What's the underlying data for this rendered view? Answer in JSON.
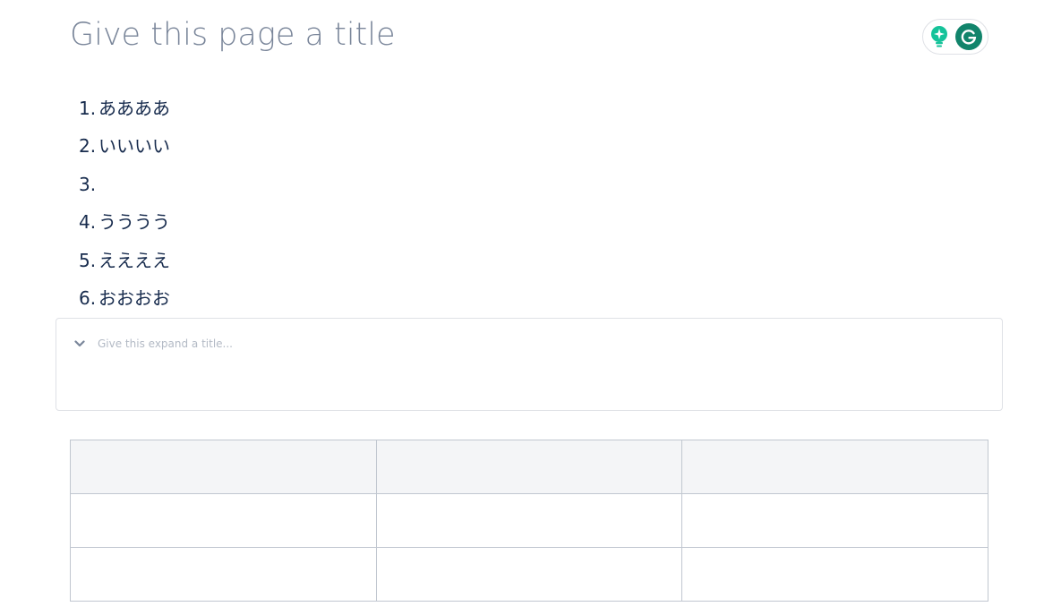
{
  "page": {
    "title_placeholder": "Give this page a title"
  },
  "grammarly": {
    "assistant_icon": "lightbulb-icon",
    "logo_icon": "grammarly-g-icon",
    "colors": {
      "bulb": "#15c39a",
      "logo": "#11846b"
    }
  },
  "list": {
    "items": [
      {
        "number": "1.",
        "text": "ああああ"
      },
      {
        "number": "2.",
        "text": "いいいい"
      },
      {
        "number": "3.",
        "text": ""
      },
      {
        "number": "4.",
        "text": "うううう"
      },
      {
        "number": "5.",
        "text": "ええええ"
      },
      {
        "number": "6.",
        "text": "おおおお"
      }
    ]
  },
  "expand": {
    "icon": "chevron-down-icon",
    "title_placeholder": "Give this expand a title..."
  },
  "table": {
    "header": [
      "",
      "",
      ""
    ],
    "rows": [
      [
        "",
        "",
        ""
      ],
      [
        "",
        "",
        ""
      ]
    ]
  }
}
